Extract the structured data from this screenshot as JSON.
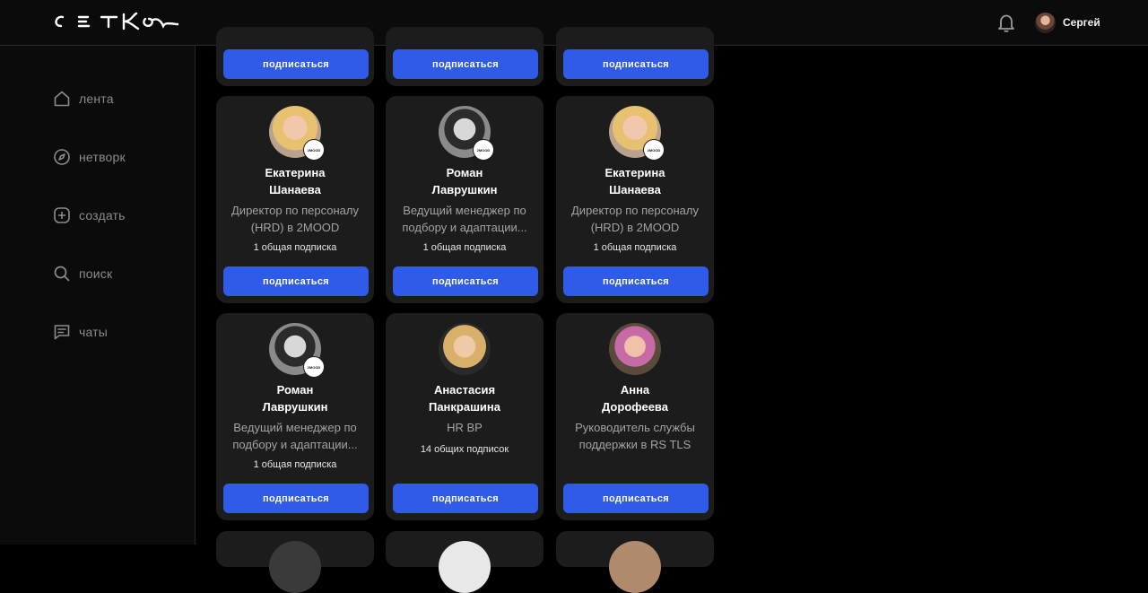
{
  "header": {
    "logo_text": "СЕТКА",
    "user_name": "Сергей"
  },
  "sidebar": {
    "items": [
      {
        "label": "лента",
        "icon": "home-icon"
      },
      {
        "label": "нетворк",
        "icon": "compass-icon"
      },
      {
        "label": "создать",
        "icon": "plus-square-icon"
      },
      {
        "label": "поиск",
        "icon": "search-icon"
      },
      {
        "label": "чаты",
        "icon": "chat-icon"
      }
    ]
  },
  "subscribe_label": "подписаться",
  "cards": [
    {
      "name_line1": "Екатерина",
      "name_line2": "Шанаева",
      "role_line1": "Директор по персоналу",
      "role_line2": "(HRD) в 2MOOD",
      "mutual": "1 общая подписка",
      "badge": "2MOOD"
    },
    {
      "name_line1": "Роман",
      "name_line2": "Лаврушкин",
      "role_line1": "Ведущий менеджер по",
      "role_line2": "подбору и адаптации...",
      "mutual": "1 общая подписка",
      "badge": "2MOOD"
    },
    {
      "name_line1": "Екатерина",
      "name_line2": "Шанаева",
      "role_line1": "Директор по персоналу",
      "role_line2": "(HRD) в 2MOOD",
      "mutual": "1 общая подписка",
      "badge": "2MOOD"
    },
    {
      "name_line1": "Роман",
      "name_line2": "Лаврушкин",
      "role_line1": "Ведущий менеджер по",
      "role_line2": "подбору и адаптации...",
      "mutual": "1 общая подписка",
      "badge": "2MOOD"
    },
    {
      "name_line1": "Анастасия",
      "name_line2": "Панкрашина",
      "role_line1": "HR BP",
      "role_line2": "",
      "mutual": "14 общих подписок",
      "badge": ""
    },
    {
      "name_line1": "Анна",
      "name_line2": "Дорофеева",
      "role_line1": "Руководитель службы",
      "role_line2": "поддержки в RS TLS",
      "mutual": "",
      "badge": ""
    }
  ],
  "colors": {
    "accent": "#2f5be8",
    "card_bg": "#1c1c1c",
    "page_bg": "#000000",
    "muted_text": "#a3a3a3"
  }
}
